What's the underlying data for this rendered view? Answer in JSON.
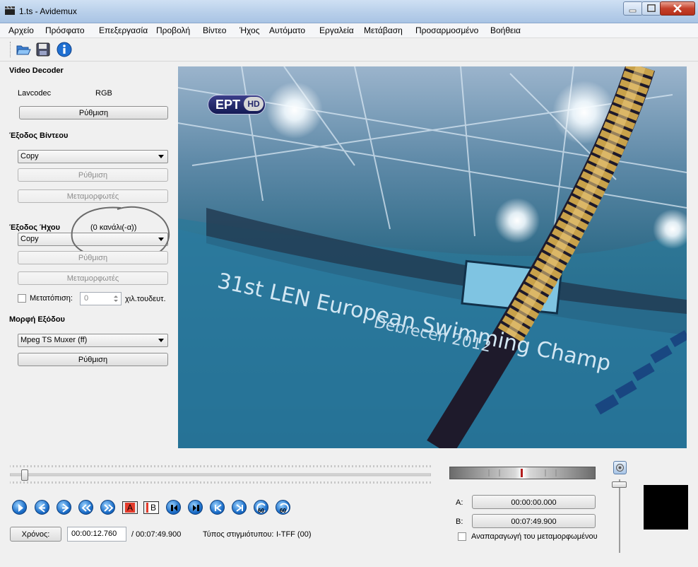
{
  "window": {
    "title": "1.ts - Avidemux"
  },
  "menu": [
    "Αρχείο",
    "Πρόσφατο",
    "Επεξεργασία",
    "Προβολή",
    "Βίντεο",
    "Ήχος",
    "Αυτόματο",
    "Εργαλεία",
    "Μετάβαση",
    "Προσαρμοσμένο",
    "Βοήθεια"
  ],
  "toolbar": {
    "open_icon": "folder-open-icon",
    "save_icon": "floppy-save-icon",
    "info_icon": "info-icon"
  },
  "left": {
    "video_decoder": {
      "heading": "Video Decoder",
      "decoder": "Lavcodec",
      "colorspace": "RGB",
      "configure": "Ρύθμιση"
    },
    "video_output": {
      "heading": "Έξοδος Βίντεου",
      "codec": "Copy",
      "configure": "Ρύθμιση",
      "filters": "Μεταμορφωτές"
    },
    "audio_output": {
      "heading": "Έξοδος Ήχου",
      "channels": "(0 κανάλι(-α))",
      "codec": "Copy",
      "configure": "Ρύθμιση",
      "filters": "Μεταμορφωτές",
      "shift_label": "Μετατόπιση:",
      "shift_value": "0",
      "shift_unit": "χιλ.τουδευτ."
    },
    "output_format": {
      "heading": "Μορφή Εξόδου",
      "muxer": "Mpeg TS Muxer (ff)",
      "configure": "Ρύθμιση"
    }
  },
  "video_overlay": {
    "channel_logo": "ΕΡΤ",
    "channel_logo_hd": "HD",
    "banner_line1": "31st LEN European Swimming Champ",
    "banner_line2": "Debrecen 2012"
  },
  "playback": {
    "marker_a": "A",
    "marker_b": "B",
    "icons": [
      "play-icon",
      "rewind-icon",
      "forward-icon",
      "previous-frame-icon",
      "next-frame-icon",
      "marker-a-icon",
      "marker-b-icon",
      "previous-black-frame-icon",
      "next-black-frame-icon",
      "go-first-icon",
      "go-last-icon",
      "back-60-icon",
      "forward-60-icon"
    ],
    "seek_label": "60"
  },
  "time": {
    "button": "Χρόνος:",
    "current": "00:00:12.760",
    "total": "/ 00:07:49.900",
    "frame_type_label": "Τύπος στιγμιότυπου:",
    "frame_type": "I-TFF (00)"
  },
  "selection": {
    "a_label": "A:",
    "a_time": "00:00:00.000",
    "b_label": "B:",
    "b_time": "00:07:49.900",
    "play_filtered": "Αναπαραγωγή του μεταμορφωμένου"
  },
  "slider": {
    "position": 0.027
  },
  "volume": {
    "level": 0.97
  }
}
